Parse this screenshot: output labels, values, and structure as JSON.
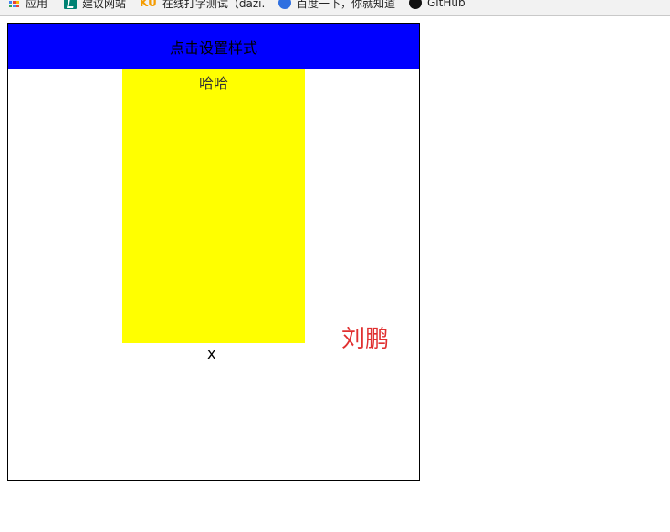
{
  "bookmarks": [
    {
      "label": "应用",
      "icon": "apps-icon"
    },
    {
      "label": "建议网站",
      "icon": "bing-icon"
    },
    {
      "label": "在线打字测试（dazi.",
      "icon": "ku-icon"
    },
    {
      "label": "百度一下，你就知道",
      "icon": "baidu-icon"
    },
    {
      "label": "GitHub",
      "icon": "github-icon"
    }
  ],
  "ku_icon_text": "KU",
  "demo": {
    "header_text": "点击设置样式",
    "yellow_text": "哈哈",
    "x_text": "x",
    "name_text": "刘鹏"
  },
  "colors": {
    "header_bg": "#0000ff",
    "yellow_bg": "#ffff00",
    "name_color": "#e03030"
  }
}
